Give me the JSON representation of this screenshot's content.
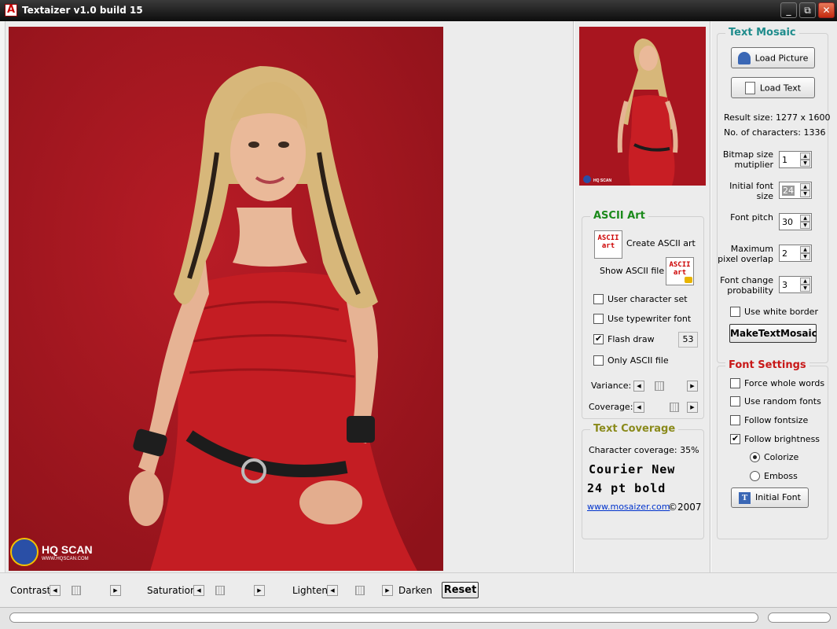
{
  "window": {
    "title": "Textaizer v1.0 build 15",
    "minimize_glyph": "_",
    "maximize_glyph": "⧉",
    "close_glyph": "✕"
  },
  "photo": {
    "watermark_main": "HQ SCAN",
    "watermark_sub": "WWW.HQSCAN.COM"
  },
  "thumbnail": {
    "watermark": "HQ SCAN"
  },
  "ascii_art": {
    "title": "ASCII Art",
    "create_label": "Create ASCII art",
    "create_icon_text": "ASCII art",
    "show_label": "Show ASCII file",
    "show_icon_text": "ASCII art",
    "user_charset": "User character set",
    "typewriter": "Use typewriter font",
    "flash_draw": "Flash draw",
    "flash_value": "53",
    "only_ascii": "Only ASCII file",
    "variance": "Variance:",
    "coverage": "Coverage:",
    "checks": {
      "user_charset": false,
      "typewriter": false,
      "flash_draw": true,
      "only_ascii": false
    }
  },
  "text_coverage": {
    "title": "Text Coverage",
    "character_coverage": "Character coverage: 35%",
    "font_name": "Courier New",
    "font_size": "24 pt bold",
    "link": "www.mosaizer.com",
    "copyright": "©2007"
  },
  "text_mosaic": {
    "title": "Text Mosaic",
    "load_picture": "Load Picture",
    "load_text": "Load Text",
    "result_size": "Result size: 1277 x 1600",
    "num_chars": "No. of characters: 1336",
    "bitmap_label": "Bitmap size mutiplier",
    "bitmap_value": "1",
    "initial_font_label": "Initial font size",
    "initial_font_value": "24",
    "pitch_label": "Font pitch",
    "pitch_value": "30",
    "overlap_label": "Maximum pixel overlap",
    "overlap_value": "2",
    "change_label": "Font change probability",
    "change_value": "3",
    "white_border": "Use white border",
    "white_border_checked": false,
    "make_button": "MakeTextMosaic"
  },
  "font_settings": {
    "title": "Font Settings",
    "force_whole": "Force whole words",
    "random_fonts": "Use random fonts",
    "follow_size": "Follow fontsize",
    "follow_brightness": "Follow brightness",
    "colorize": "Colorize",
    "emboss": "Emboss",
    "initial_font_button": "Initial Font",
    "checks": {
      "force_whole": false,
      "random_fonts": false,
      "follow_size": false,
      "follow_brightness": true
    },
    "radio_selected": "Colorize"
  },
  "adjust_bar": {
    "contrast": "Contrast",
    "saturation": "Saturation",
    "lighten": "Lighten",
    "darken": "Darken",
    "reset": "Reset"
  },
  "colors": {
    "group_title_green": "#1b8a1b",
    "group_title_teal": "#1f8c8c",
    "group_title_red": "#c81818",
    "group_title_olive": "#8a8a1b",
    "backdrop_red": "#a8151f",
    "dress_red": "#c81e24"
  }
}
